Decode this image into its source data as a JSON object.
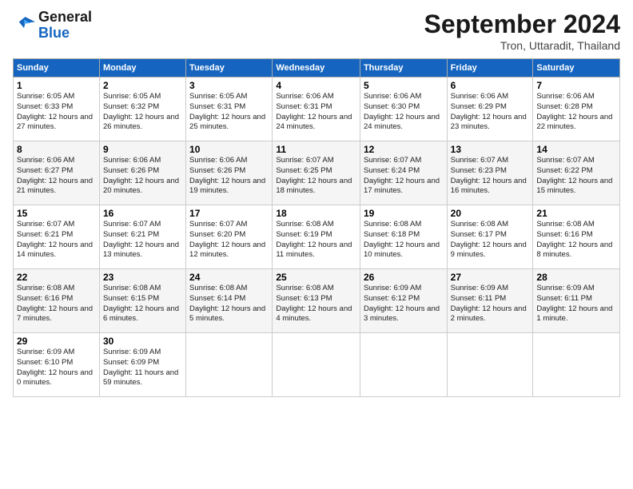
{
  "logo": {
    "general": "General",
    "blue": "Blue"
  },
  "header": {
    "month": "September 2024",
    "location": "Tron, Uttaradit, Thailand"
  },
  "weekdays": [
    "Sunday",
    "Monday",
    "Tuesday",
    "Wednesday",
    "Thursday",
    "Friday",
    "Saturday"
  ],
  "weeks": [
    [
      {
        "day": "1",
        "sunrise": "6:05 AM",
        "sunset": "6:33 PM",
        "daylight": "12 hours and 27 minutes."
      },
      {
        "day": "2",
        "sunrise": "6:05 AM",
        "sunset": "6:32 PM",
        "daylight": "12 hours and 26 minutes."
      },
      {
        "day": "3",
        "sunrise": "6:05 AM",
        "sunset": "6:31 PM",
        "daylight": "12 hours and 25 minutes."
      },
      {
        "day": "4",
        "sunrise": "6:06 AM",
        "sunset": "6:31 PM",
        "daylight": "12 hours and 24 minutes."
      },
      {
        "day": "5",
        "sunrise": "6:06 AM",
        "sunset": "6:30 PM",
        "daylight": "12 hours and 24 minutes."
      },
      {
        "day": "6",
        "sunrise": "6:06 AM",
        "sunset": "6:29 PM",
        "daylight": "12 hours and 23 minutes."
      },
      {
        "day": "7",
        "sunrise": "6:06 AM",
        "sunset": "6:28 PM",
        "daylight": "12 hours and 22 minutes."
      }
    ],
    [
      {
        "day": "8",
        "sunrise": "6:06 AM",
        "sunset": "6:27 PM",
        "daylight": "12 hours and 21 minutes."
      },
      {
        "day": "9",
        "sunrise": "6:06 AM",
        "sunset": "6:26 PM",
        "daylight": "12 hours and 20 minutes."
      },
      {
        "day": "10",
        "sunrise": "6:06 AM",
        "sunset": "6:26 PM",
        "daylight": "12 hours and 19 minutes."
      },
      {
        "day": "11",
        "sunrise": "6:07 AM",
        "sunset": "6:25 PM",
        "daylight": "12 hours and 18 minutes."
      },
      {
        "day": "12",
        "sunrise": "6:07 AM",
        "sunset": "6:24 PM",
        "daylight": "12 hours and 17 minutes."
      },
      {
        "day": "13",
        "sunrise": "6:07 AM",
        "sunset": "6:23 PM",
        "daylight": "12 hours and 16 minutes."
      },
      {
        "day": "14",
        "sunrise": "6:07 AM",
        "sunset": "6:22 PM",
        "daylight": "12 hours and 15 minutes."
      }
    ],
    [
      {
        "day": "15",
        "sunrise": "6:07 AM",
        "sunset": "6:21 PM",
        "daylight": "12 hours and 14 minutes."
      },
      {
        "day": "16",
        "sunrise": "6:07 AM",
        "sunset": "6:21 PM",
        "daylight": "12 hours and 13 minutes."
      },
      {
        "day": "17",
        "sunrise": "6:07 AM",
        "sunset": "6:20 PM",
        "daylight": "12 hours and 12 minutes."
      },
      {
        "day": "18",
        "sunrise": "6:08 AM",
        "sunset": "6:19 PM",
        "daylight": "12 hours and 11 minutes."
      },
      {
        "day": "19",
        "sunrise": "6:08 AM",
        "sunset": "6:18 PM",
        "daylight": "12 hours and 10 minutes."
      },
      {
        "day": "20",
        "sunrise": "6:08 AM",
        "sunset": "6:17 PM",
        "daylight": "12 hours and 9 minutes."
      },
      {
        "day": "21",
        "sunrise": "6:08 AM",
        "sunset": "6:16 PM",
        "daylight": "12 hours and 8 minutes."
      }
    ],
    [
      {
        "day": "22",
        "sunrise": "6:08 AM",
        "sunset": "6:16 PM",
        "daylight": "12 hours and 7 minutes."
      },
      {
        "day": "23",
        "sunrise": "6:08 AM",
        "sunset": "6:15 PM",
        "daylight": "12 hours and 6 minutes."
      },
      {
        "day": "24",
        "sunrise": "6:08 AM",
        "sunset": "6:14 PM",
        "daylight": "12 hours and 5 minutes."
      },
      {
        "day": "25",
        "sunrise": "6:08 AM",
        "sunset": "6:13 PM",
        "daylight": "12 hours and 4 minutes."
      },
      {
        "day": "26",
        "sunrise": "6:09 AM",
        "sunset": "6:12 PM",
        "daylight": "12 hours and 3 minutes."
      },
      {
        "day": "27",
        "sunrise": "6:09 AM",
        "sunset": "6:11 PM",
        "daylight": "12 hours and 2 minutes."
      },
      {
        "day": "28",
        "sunrise": "6:09 AM",
        "sunset": "6:11 PM",
        "daylight": "12 hours and 1 minute."
      }
    ],
    [
      {
        "day": "29",
        "sunrise": "6:09 AM",
        "sunset": "6:10 PM",
        "daylight": "12 hours and 0 minutes."
      },
      {
        "day": "30",
        "sunrise": "6:09 AM",
        "sunset": "6:09 PM",
        "daylight": "11 hours and 59 minutes."
      },
      null,
      null,
      null,
      null,
      null
    ]
  ]
}
